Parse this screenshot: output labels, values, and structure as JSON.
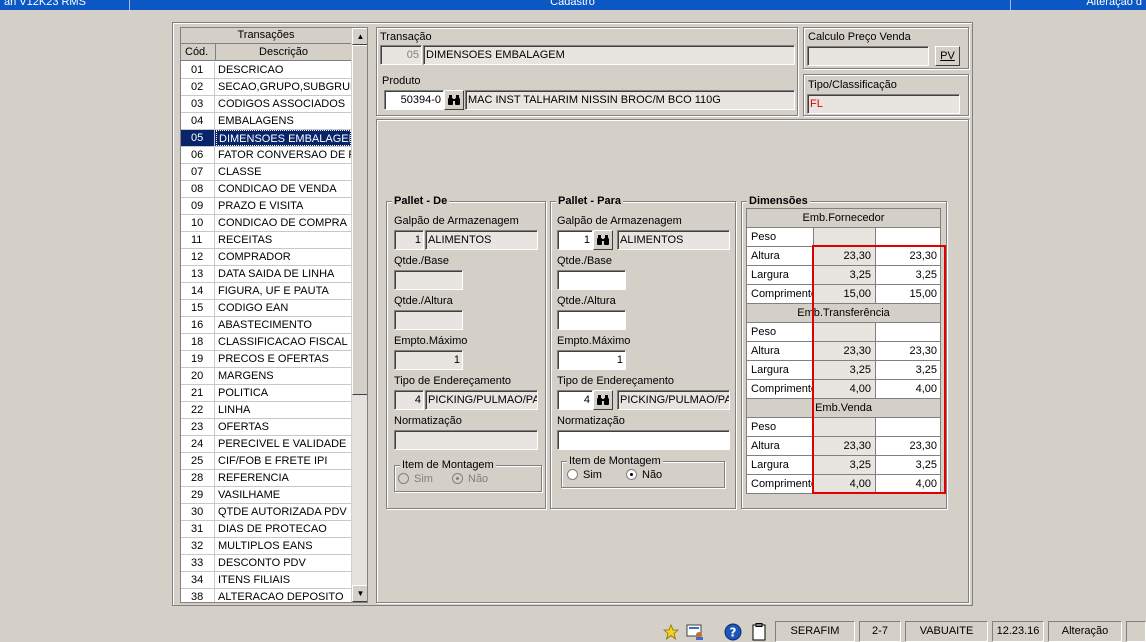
{
  "titlebar": {
    "left": "an V12K23 RMS",
    "center": "Cadastro",
    "right": "Alteração d"
  },
  "list": {
    "title": "Transações",
    "col_code": "Cód.",
    "col_desc": "Descrição",
    "items": [
      {
        "code": "01",
        "desc": "DESCRICAO"
      },
      {
        "code": "02",
        "desc": "SECAO,GRUPO,SUBGRUPO"
      },
      {
        "code": "03",
        "desc": "CODIGOS ASSOCIADOS"
      },
      {
        "code": "04",
        "desc": "EMBALAGENS"
      },
      {
        "code": "05",
        "desc": "DIMENSOES EMBALAGEM"
      },
      {
        "code": "06",
        "desc": "FATOR CONVERSAO DE PR"
      },
      {
        "code": "07",
        "desc": "CLASSE"
      },
      {
        "code": "08",
        "desc": "CONDICAO DE VENDA"
      },
      {
        "code": "09",
        "desc": "PRAZO E VISITA"
      },
      {
        "code": "10",
        "desc": "CONDICAO DE COMPRA"
      },
      {
        "code": "11",
        "desc": "RECEITAS"
      },
      {
        "code": "12",
        "desc": "COMPRADOR"
      },
      {
        "code": "13",
        "desc": "DATA SAIDA DE LINHA"
      },
      {
        "code": "14",
        "desc": "FIGURA, UF E PAUTA"
      },
      {
        "code": "15",
        "desc": "CODIGO EAN"
      },
      {
        "code": "16",
        "desc": "ABASTECIMENTO"
      },
      {
        "code": "18",
        "desc": "CLASSIFICACAO FISCAL"
      },
      {
        "code": "19",
        "desc": "PRECOS E OFERTAS"
      },
      {
        "code": "20",
        "desc": "MARGENS"
      },
      {
        "code": "21",
        "desc": "POLITICA"
      },
      {
        "code": "22",
        "desc": "LINHA"
      },
      {
        "code": "23",
        "desc": "OFERTAS"
      },
      {
        "code": "24",
        "desc": "PERECIVEL E VALIDADE"
      },
      {
        "code": "25",
        "desc": "CIF/FOB E FRETE IPI"
      },
      {
        "code": "28",
        "desc": "REFERENCIA"
      },
      {
        "code": "29",
        "desc": "VASILHAME"
      },
      {
        "code": "30",
        "desc": "QTDE AUTORIZADA PDV"
      },
      {
        "code": "31",
        "desc": "DIAS DE PROTECAO"
      },
      {
        "code": "32",
        "desc": "MULTIPLOS EANS"
      },
      {
        "code": "33",
        "desc": "DESCONTO PDV"
      },
      {
        "code": "34",
        "desc": "ITENS FILIAIS"
      },
      {
        "code": "38",
        "desc": "ALTERACAO DEPOSITO"
      }
    ]
  },
  "transacao": {
    "label": "Transação",
    "code": "05",
    "desc": "DIMENSOES EMBALAGEM"
  },
  "produto": {
    "label": "Produto",
    "code": "50394-0",
    "desc": "MAC INST TALHARIM NISSIN BROC/M BCO 110G"
  },
  "calculo": {
    "label": "Calculo Preço Venda",
    "value": "",
    "button": "PV"
  },
  "tipo": {
    "label": "Tipo/Classificação",
    "value": "FL"
  },
  "pallet_de": {
    "title": "Pallet - De",
    "galpao_label": "Galpão de Armazenagem",
    "galpao_code": "1",
    "galpao_desc": "ALIMENTOS",
    "qtde_base_label": "Qtde./Base",
    "qtde_base": "",
    "qtde_altura_label": "Qtde./Altura",
    "qtde_altura": "",
    "empto_label": "Empto.Máximo",
    "empto": "1",
    "tipo_end_label": "Tipo de Endereçamento",
    "tipo_end_code": "4",
    "tipo_end_desc": "PICKING/PULMAO/PALI",
    "normal_label": "Normatização",
    "normal": "",
    "montagem_label": "Item de Montagem",
    "sim": "Sim",
    "nao": "Não"
  },
  "pallet_para": {
    "title": "Pallet - Para",
    "galpao_label": "Galpão de Armazenagem",
    "galpao_code": "1",
    "galpao_desc": "ALIMENTOS",
    "qtde_base_label": "Qtde./Base",
    "qtde_base": "",
    "qtde_altura_label": "Qtde./Altura",
    "qtde_altura": "",
    "empto_label": "Empto.Máximo",
    "empto": "1",
    "tipo_end_label": "Tipo de Endereçamento",
    "tipo_end_code": "4",
    "tipo_end_desc": "PICKING/PULMAO/PALI",
    "normal_label": "Normatização",
    "normal": "",
    "montagem_label": "Item de Montagem",
    "sim": "Sim",
    "nao": "Não"
  },
  "dimensoes": {
    "title": "Dimensões",
    "sections": [
      {
        "name": "Emb.Fornecedor",
        "rows": [
          {
            "label": "Peso",
            "v1": "",
            "v2": ""
          },
          {
            "label": "Altura",
            "v1": "23,30",
            "v2": "23,30"
          },
          {
            "label": "Largura",
            "v1": "3,25",
            "v2": "3,25"
          },
          {
            "label": "Comprimento",
            "v1": "15,00",
            "v2": "15,00"
          }
        ]
      },
      {
        "name": "Emb.Transferência",
        "rows": [
          {
            "label": "Peso",
            "v1": "",
            "v2": ""
          },
          {
            "label": "Altura",
            "v1": "23,30",
            "v2": "23,30"
          },
          {
            "label": "Largura",
            "v1": "3,25",
            "v2": "3,25"
          },
          {
            "label": "Comprimento",
            "v1": "4,00",
            "v2": "4,00"
          }
        ]
      },
      {
        "name": "Emb.Venda",
        "rows": [
          {
            "label": "Peso",
            "v1": "",
            "v2": ""
          },
          {
            "label": "Altura",
            "v1": "23,30",
            "v2": "23,30"
          },
          {
            "label": "Largura",
            "v1": "3,25",
            "v2": "3,25"
          },
          {
            "label": "Comprimento",
            "v1": "4,00",
            "v2": "4,00"
          }
        ]
      }
    ]
  },
  "status": {
    "user": "SERAFIM",
    "code": "2-7",
    "host": "VABUAITE",
    "time": "12.23.16",
    "mode": "Alteração"
  },
  "colors": {
    "title_bar": "#0b58c4",
    "selection": "#0a246a",
    "highlight_box": "#e00000",
    "tipo_text": "#e00000"
  },
  "icons": [
    "binoculars-icon",
    "star-icon",
    "help-icon",
    "clipboard-icon",
    "user-screen-icon"
  ]
}
